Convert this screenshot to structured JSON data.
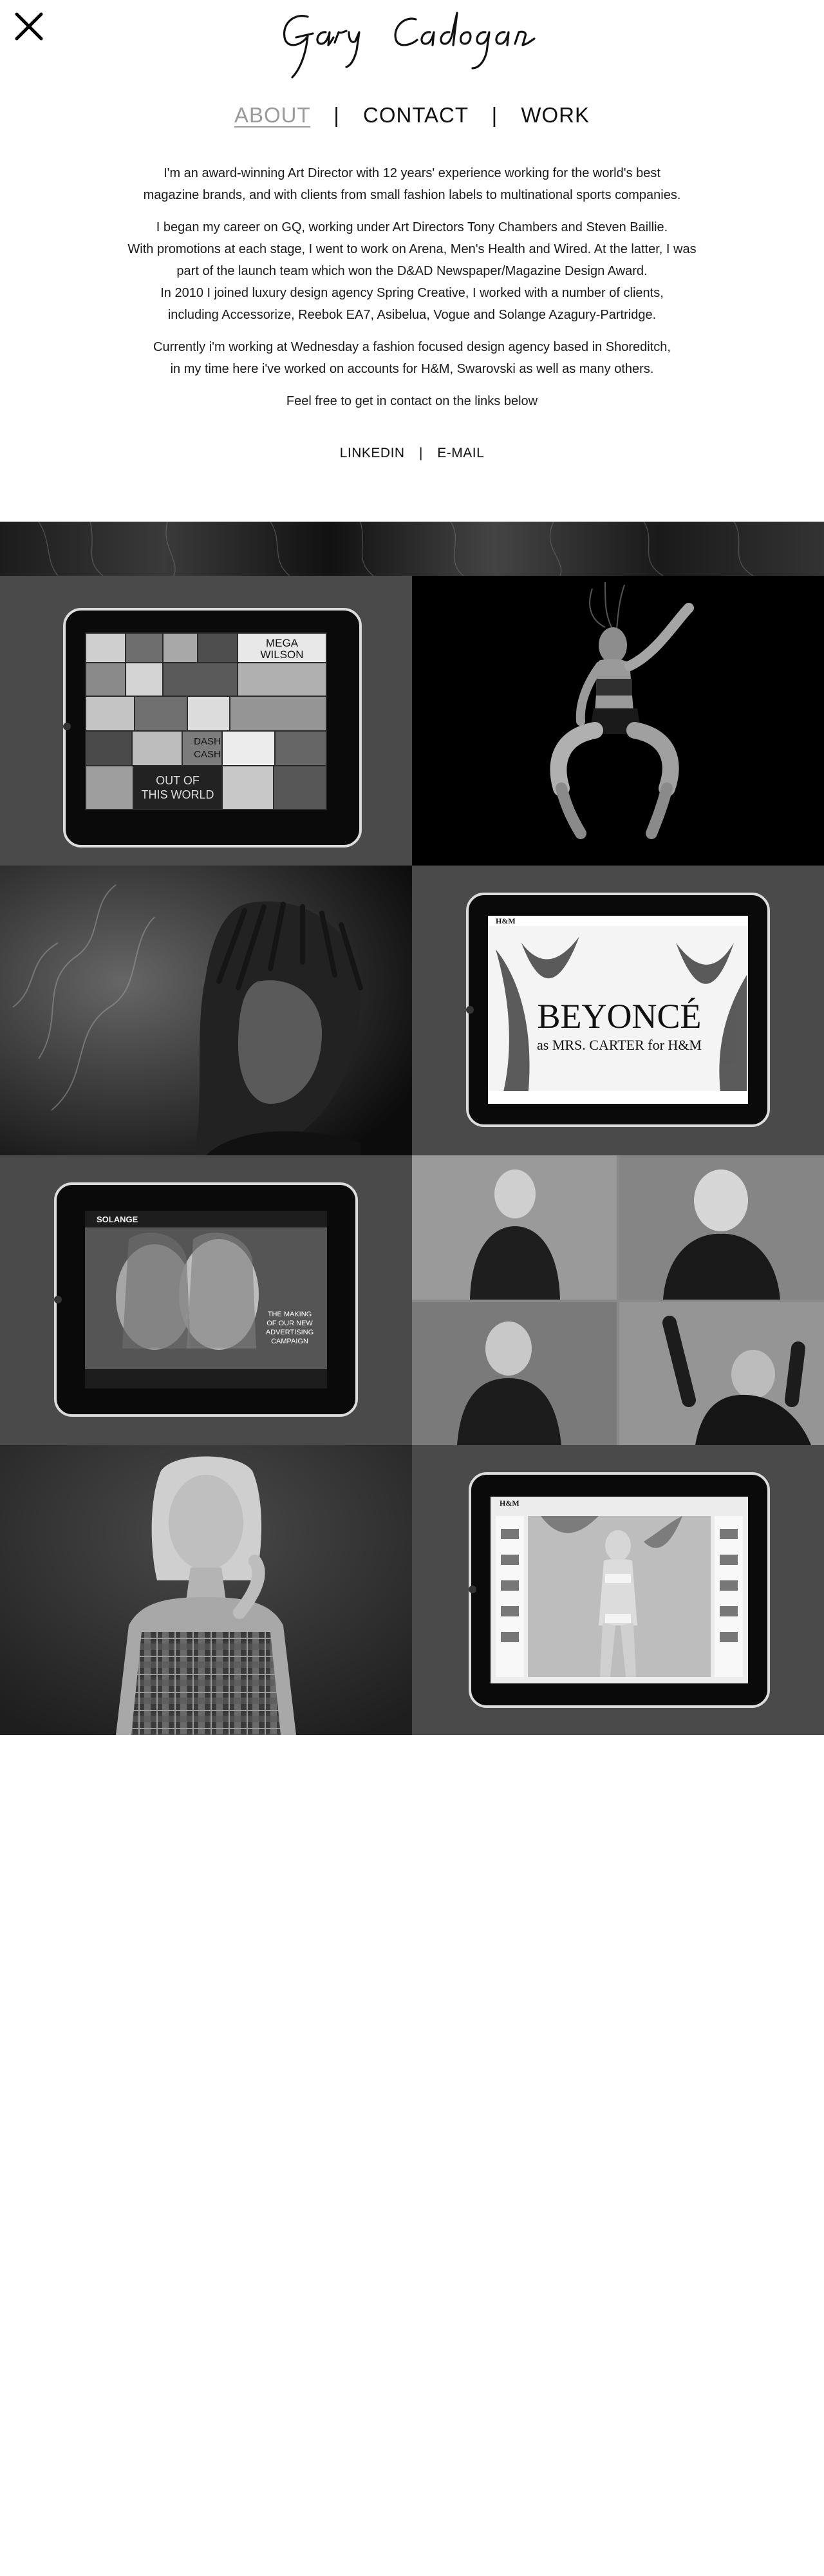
{
  "header": {
    "close_icon": "close-icon",
    "logo_text": "Gary Cadogan"
  },
  "nav": {
    "items": [
      {
        "label": "ABOUT",
        "active": true
      },
      {
        "label": "CONTACT",
        "active": false
      },
      {
        "label": "WORK",
        "active": false
      }
    ],
    "separator": "|"
  },
  "bio": {
    "p1_l1": "I'm an award-winning Art Director with 12 years' experience working for the world's best",
    "p1_l2": "magazine brands, and with clients from small fashion labels to multinational sports companies.",
    "p2_l1": "I began my career on GQ, working under Art Directors Tony Chambers and Steven Baillie.",
    "p2_l2": "With promotions at each stage, I went to work on Arena, Men's Health and Wired. At the latter, I was",
    "p2_l3": "part of the launch team which won the D&AD Newspaper/Magazine Design Award.",
    "p2_l4": "In 2010 I joined luxury design agency Spring Creative, I worked with a number of clients,",
    "p2_l5": "including Accessorize, Reebok EA7, Asibelua, Vogue and Solange Azagury-Partridge.",
    "p3_l1": "Currently i'm working at Wednesday a fashion focused design agency based in Shoreditch,",
    "p3_l2": "in my time here i've worked on accounts for H&M, Swarovski as well as many others.",
    "p4": "Feel free to get in contact on the links below"
  },
  "links": {
    "linkedin": "LINKEDIN",
    "separator": "|",
    "email": "E-MAIL"
  },
  "work": {
    "tiles": [
      {
        "name": "tile-magazine-ipad",
        "tile_texts": [
          "MEGA",
          "WILSON",
          "DASH",
          "CASH",
          "OUT OF",
          "THIS WORLD"
        ]
      },
      {
        "name": "tile-athlete-jump"
      },
      {
        "name": "tile-smoke-portrait"
      },
      {
        "name": "tile-hm-beyonce-ipad",
        "headline": "BEYONCÉ",
        "subline": "as MRS. CARTER for H&M",
        "brand": "H&M"
      },
      {
        "name": "tile-solange-ipad",
        "brand": "SOLANGE",
        "caption_l1": "THE MAKING",
        "caption_l2": "OF OUR NEW",
        "caption_l3": "ADVERTISING",
        "caption_l4": "CAMPAIGN"
      },
      {
        "name": "tile-man-portrait-grid"
      },
      {
        "name": "tile-model-portrait"
      },
      {
        "name": "tile-hm-swimwear-ipad",
        "brand": "H&M"
      }
    ]
  },
  "colors": {
    "tile_grey": "#4a4a4a",
    "nav_active": "#9a9a9a",
    "text": "#111111"
  }
}
